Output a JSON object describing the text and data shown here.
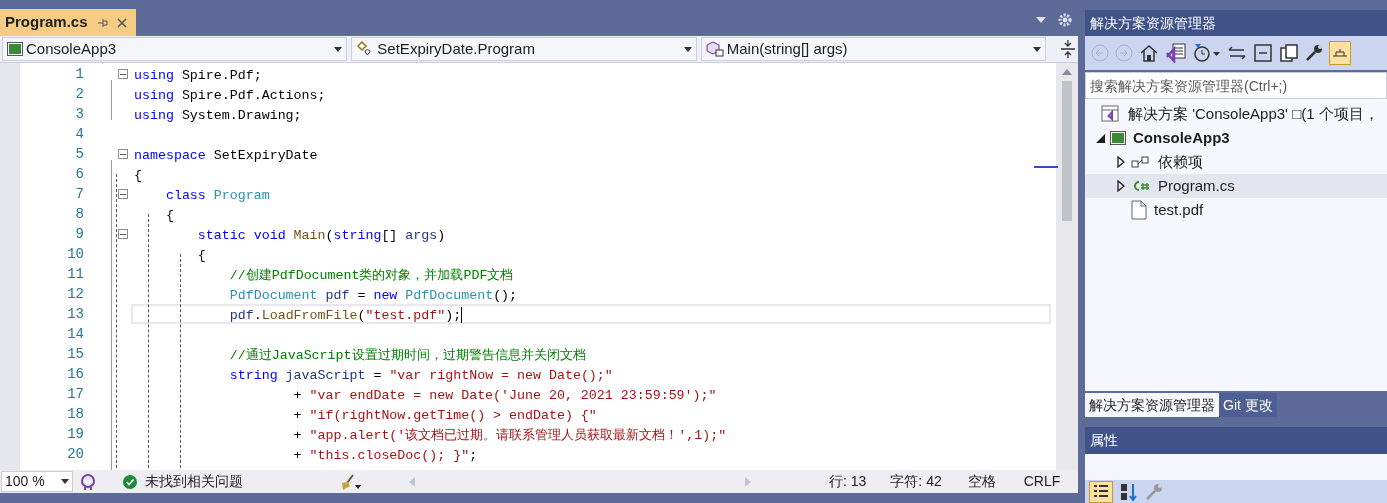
{
  "tab": {
    "title": "Program.cs",
    "selected": true
  },
  "nav": [
    {
      "kind": "project",
      "text": "ConsoleApp3"
    },
    {
      "kind": "class",
      "text": "SetExpiryDate.Program"
    },
    {
      "kind": "method",
      "text": "Main(string[] args)"
    }
  ],
  "code": [
    {
      "number": "1",
      "fold": true,
      "current": false,
      "tokens": [
        {
          "kind": "kw",
          "text": "using"
        },
        {
          "kind": "plain",
          "text": " Spire.Pdf;"
        }
      ]
    },
    {
      "number": "2",
      "fold": false,
      "current": false,
      "tokens": [
        {
          "kind": "kw",
          "text": "using"
        },
        {
          "kind": "plain",
          "text": " Spire.Pdf.Actions;"
        }
      ]
    },
    {
      "number": "3",
      "fold": false,
      "current": false,
      "tokens": [
        {
          "kind": "kw",
          "text": "using"
        },
        {
          "kind": "plain",
          "text": " System.Drawing;"
        }
      ]
    },
    {
      "number": "4",
      "fold": false,
      "current": false
    },
    {
      "number": "5",
      "fold": true,
      "current": false,
      "tokens": [
        {
          "kind": "kw",
          "text": "namespace"
        },
        {
          "kind": "plain",
          "text": " SetExpiryDate"
        }
      ]
    },
    {
      "number": "6",
      "fold": false,
      "current": false,
      "tokens": [
        {
          "kind": "plain",
          "text": "{"
        }
      ]
    },
    {
      "number": "7",
      "fold": true,
      "current": false,
      "tokens": [
        {
          "kind": "kw",
          "text": "    class"
        },
        {
          "kind": "type",
          "text": " Program"
        }
      ]
    },
    {
      "number": "8",
      "fold": false,
      "current": false,
      "tokens": [
        {
          "kind": "plain",
          "text": "    {"
        }
      ]
    },
    {
      "number": "9",
      "fold": true,
      "current": false,
      "tokens": [
        {
          "kind": "kw",
          "text": "        static void"
        },
        {
          "kind": "method",
          "text": " Main"
        },
        {
          "kind": "plain",
          "text": "("
        },
        {
          "kind": "kw",
          "text": "string"
        },
        {
          "kind": "plain",
          "text": "[] "
        },
        {
          "kind": "var",
          "text": "args"
        },
        {
          "kind": "plain",
          "text": ")"
        }
      ]
    },
    {
      "number": "10",
      "fold": false,
      "current": false,
      "tokens": [
        {
          "kind": "plain",
          "text": "        {"
        }
      ]
    },
    {
      "number": "11",
      "fold": false,
      "current": false,
      "tokens": [
        {
          "kind": "comment",
          "text": "            //创建PdfDocument类的对象，并加载PDF文档"
        }
      ]
    },
    {
      "number": "12",
      "fold": false,
      "current": false,
      "tokens": [
        {
          "kind": "type",
          "text": "            PdfDocument"
        },
        {
          "kind": "var",
          "text": " pdf"
        },
        {
          "kind": "plain",
          "text": " = "
        },
        {
          "kind": "kw",
          "text": "new"
        },
        {
          "kind": "type",
          "text": " PdfDocument"
        },
        {
          "kind": "plain",
          "text": "();"
        }
      ]
    },
    {
      "number": "13",
      "fold": false,
      "current": true,
      "tokens": [
        {
          "kind": "var",
          "text": "            pdf"
        },
        {
          "kind": "plain",
          "text": "."
        },
        {
          "kind": "method",
          "text": "LoadFromFile"
        },
        {
          "kind": "plain",
          "text": "("
        },
        {
          "kind": "string",
          "text": "\"test.pdf\""
        },
        {
          "kind": "plain",
          "text": ");"
        }
      ]
    },
    {
      "number": "14",
      "fold": false,
      "current": false
    },
    {
      "number": "15",
      "fold": false,
      "current": false,
      "tokens": [
        {
          "kind": "comment",
          "text": "            //通过JavaScript设置过期时间，过期警告信息并关闭文档"
        }
      ]
    },
    {
      "number": "16",
      "fold": false,
      "current": false,
      "tokens": [
        {
          "kind": "kw",
          "text": "            string"
        },
        {
          "kind": "var",
          "text": " javaScript"
        },
        {
          "kind": "plain",
          "text": " = "
        },
        {
          "kind": "string",
          "text": "\"var rightNow = new Date();\""
        }
      ]
    },
    {
      "number": "17",
      "fold": false,
      "current": false,
      "tokens": [
        {
          "kind": "plain",
          "text": "                    + "
        },
        {
          "kind": "string",
          "text": "\"var endDate = new Date('June 20, 2021 23:59:59');\""
        }
      ]
    },
    {
      "number": "18",
      "fold": false,
      "current": false,
      "tokens": [
        {
          "kind": "plain",
          "text": "                    + "
        },
        {
          "kind": "string",
          "text": "\"if(rightNow.getTime() > endDate) {\""
        }
      ]
    },
    {
      "number": "19",
      "fold": false,
      "current": false,
      "tokens": [
        {
          "kind": "plain",
          "text": "                    + "
        },
        {
          "kind": "string",
          "text": "\"app.alert('该文档已过期。请联系管理人员获取最新文档！',1);\""
        }
      ]
    },
    {
      "number": "20",
      "fold": false,
      "current": false,
      "tokens": [
        {
          "kind": "plain",
          "text": "                    + "
        },
        {
          "kind": "string",
          "text": "\"this.closeDoc(); }\""
        },
        {
          "kind": "plain",
          "text": ";"
        }
      ]
    }
  ],
  "status": {
    "zoom": "100 %",
    "issues": "未找到相关问题",
    "line": "行: 13",
    "column": "字符: 42",
    "spacing": "空格",
    "line_ending": "CRLF"
  },
  "explorer": {
    "title": "解决方案资源管理器",
    "search": {
      "placeholder": "搜索解决方案资源管理器(Ctrl+;)"
    },
    "tree": [
      {
        "kind": "solution",
        "label": "解决方案 'ConsoleApp3' □(1 个项目，",
        "selected": false,
        "children": [
          {
            "kind": "project",
            "label": "ConsoleApp3",
            "expanded": true,
            "selected": false,
            "children": [
              {
                "kind": "dependencies",
                "label": "依赖项",
                "expanded": false,
                "selected": false
              },
              {
                "kind": "csharp",
                "label": "Program.cs",
                "expanded": false,
                "selected": true
              },
              {
                "kind": "file",
                "label": "test.pdf",
                "selected": false
              }
            ]
          }
        ]
      }
    ],
    "tabs": [
      {
        "label": "解决方案资源管理器",
        "selected": true
      },
      {
        "label": "Git 更改",
        "selected": false
      }
    ],
    "properties": {
      "title": "属性"
    }
  }
}
